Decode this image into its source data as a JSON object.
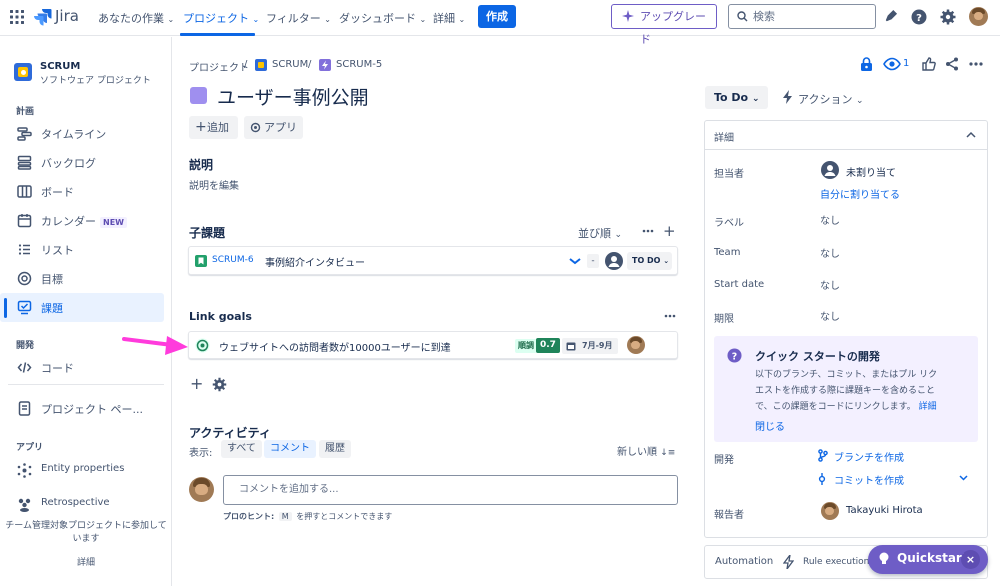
{
  "topnav": {
    "logo_text": "Jira",
    "items": [
      "あなたの作業",
      "プロジェクト",
      "フィルター",
      "ダッシュボード",
      "詳細"
    ],
    "create_label": "作成",
    "upgrade_label": "アップグレード",
    "search_placeholder": "検索"
  },
  "sidebar": {
    "project_name": "SCRUM",
    "project_type": "ソフトウェア プロジェクト",
    "section_plan": "計画",
    "plan_items": [
      "タイムライン",
      "バックログ",
      "ボード",
      "カレンダー",
      "リスト",
      "目標",
      "課題"
    ],
    "calendar_badge": "NEW",
    "section_dev": "開発",
    "dev_items": [
      "コード"
    ],
    "project_page": "プロジェクト ペー...",
    "section_apps": "アプリ",
    "app_items": [
      "Entity properties",
      "Retrospective"
    ],
    "footer_text_1": "チーム管理対象プロジェクトに参加して",
    "footer_text_2": "います",
    "footer_link": "詳細"
  },
  "breadcrumb": {
    "projects": "プロジェクト",
    "sep": "/",
    "project": "SCRUM",
    "issue": "SCRUM-5"
  },
  "issue": {
    "title": "ユーザー事例公開",
    "add_label": "追加",
    "apps_label": "アプリ",
    "description_title": "説明",
    "description_placeholder": "説明を編集",
    "subtasks_title": "子課題",
    "sort_label": "並び順",
    "subtask": {
      "key": "SCRUM-6",
      "summary": "事例紹介インタビュー",
      "priority": "-",
      "status": "TO DO"
    },
    "goals_title": "Link goals",
    "goal": {
      "summary": "ウェブサイトへの訪問者数が10000ユーザーに到達",
      "status": "順調",
      "score": "0.7",
      "period": "7月-9月"
    },
    "activity_title": "アクティビティ",
    "show_label": "表示:",
    "activity_tabs": [
      "すべて",
      "コメント",
      "履歴"
    ],
    "sort_newest": "新しい順",
    "comment_placeholder": "コメントを追加する...",
    "tip_prefix": "プロのヒント:",
    "tip_key": "M",
    "tip_suffix": "を押すとコメントできます"
  },
  "header_actions": {
    "watchers": "1"
  },
  "right_panel": {
    "status_label": "To Do",
    "actions_label": "アクション",
    "details_title": "詳細",
    "assignee_label": "担当者",
    "assignee_value": "未割り当て",
    "assign_me": "自分に割り当てる",
    "labels_label": "ラベル",
    "labels_value": "なし",
    "team_label": "Team",
    "team_value": "なし",
    "start_label": "Start date",
    "start_value": "なし",
    "due_label": "期限",
    "due_value": "なし",
    "quickstart_title": "クイック スタートの開発",
    "quickstart_body_1": "以下のブランチ、コミット、またはプル リク",
    "quickstart_body_2": "エストを作成する際に課題キーを含めること",
    "quickstart_body_3": "で、この課題をコードにリンクします。",
    "quickstart_link": "詳細",
    "quickstart_close": "閉じる",
    "dev_label": "開発",
    "create_branch": "ブランチを作成",
    "create_commit": "コミットを作成",
    "reporter_label": "報告者",
    "reporter_value": "Takayuki Hirota",
    "automation_label": "Automation",
    "rule_executions": "Rule executions"
  },
  "quickstart_button": {
    "label": "Quickstart"
  },
  "colors": {
    "brand": "#0c66e4",
    "purple": "#6e5dc6",
    "annotation_arrow": "#ff3bdc",
    "success": "#1f845a"
  }
}
